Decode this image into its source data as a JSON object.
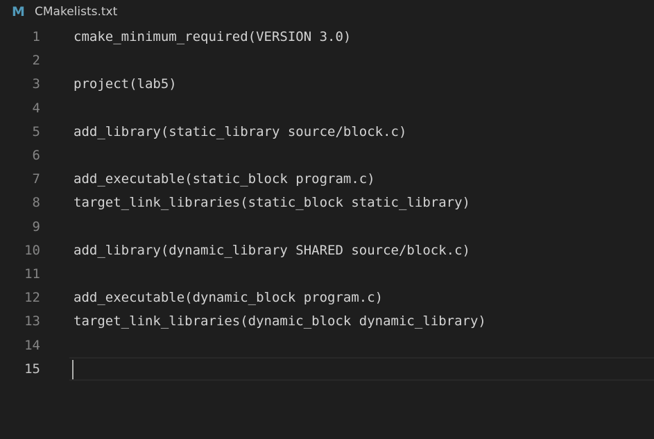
{
  "tab": {
    "icon": "M",
    "file_name": "CMakelists.txt"
  },
  "editor": {
    "current_line": 15,
    "lines": [
      {
        "number": "1",
        "text": "cmake_minimum_required(VERSION 3.0)"
      },
      {
        "number": "2",
        "text": ""
      },
      {
        "number": "3",
        "text": "project(lab5)"
      },
      {
        "number": "4",
        "text": ""
      },
      {
        "number": "5",
        "text": "add_library(static_library source/block.c)"
      },
      {
        "number": "6",
        "text": ""
      },
      {
        "number": "7",
        "text": "add_executable(static_block program.c)"
      },
      {
        "number": "8",
        "text": "target_link_libraries(static_block static_library)"
      },
      {
        "number": "9",
        "text": ""
      },
      {
        "number": "10",
        "text": "add_library(dynamic_library SHARED source/block.c)"
      },
      {
        "number": "11",
        "text": ""
      },
      {
        "number": "12",
        "text": "add_executable(dynamic_block program.c)"
      },
      {
        "number": "13",
        "text": "target_link_libraries(dynamic_block dynamic_library)"
      },
      {
        "number": "14",
        "text": ""
      },
      {
        "number": "15",
        "text": ""
      }
    ]
  },
  "colors": {
    "background": "#1e1e1e",
    "text": "#d4d4d4",
    "line_number": "#858585",
    "active_line_number": "#c6c6c6",
    "icon": "#519aba"
  }
}
